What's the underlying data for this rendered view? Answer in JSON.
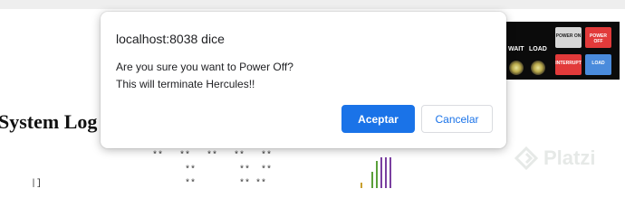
{
  "page": {
    "heading": "System Log",
    "ascii_rows": [
      "**   **   **   **   **",
      "**        **  **",
      "**        ** **",
      "|]"
    ]
  },
  "control_panel": {
    "wait_label": "WAIT",
    "load_label": "LOAD",
    "buttons": {
      "power_on": "POWER ON",
      "power_off": "POWER OFF",
      "interrupt": "INTERRUPT",
      "load": "LOAD"
    }
  },
  "dialog": {
    "title": "localhost:8038 dice",
    "message_line1": "Are you sure you want to Power Off?",
    "message_line2": "This will terminate Hercules!!",
    "accept_label": "Aceptar",
    "cancel_label": "Cancelar"
  },
  "watermark": {
    "brand": "Platzi"
  },
  "colors": {
    "accent": "#1a73e8",
    "panel_bg": "#0b0b0b",
    "danger": "#e23a3a"
  }
}
